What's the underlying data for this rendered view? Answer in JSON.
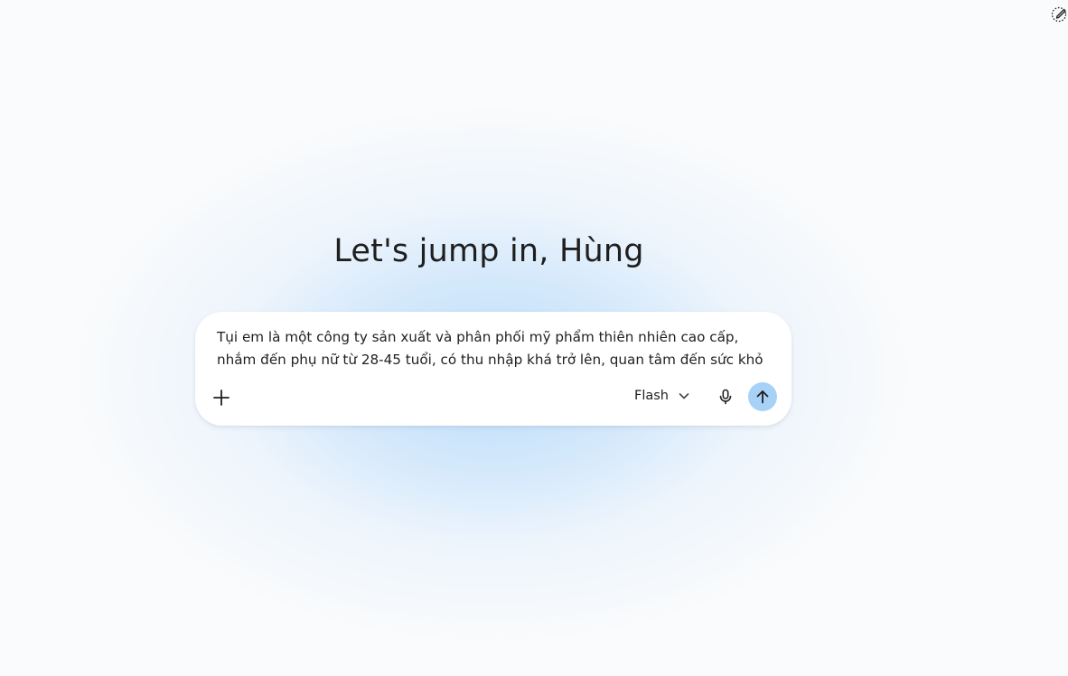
{
  "header": {
    "corner_icon": "edit-sparkle-icon"
  },
  "greeting": "Let's jump in, Hùng",
  "composer": {
    "prompt_text": "Tụi em là một công ty sản xuất và phân phối mỹ phẩm thiên nhiên cao cấp, nhắm đến phụ nữ từ 28-45 tuổi, có thu nhập khá trở lên, quan tâm đến sức khỏ",
    "add_icon": "plus-icon",
    "model_label": "Flash",
    "model_dropdown_icon": "chevron-down-icon",
    "mic_icon": "microphone-icon",
    "send_icon": "arrow-up-icon",
    "send_button_color": "#a8d1f7"
  }
}
